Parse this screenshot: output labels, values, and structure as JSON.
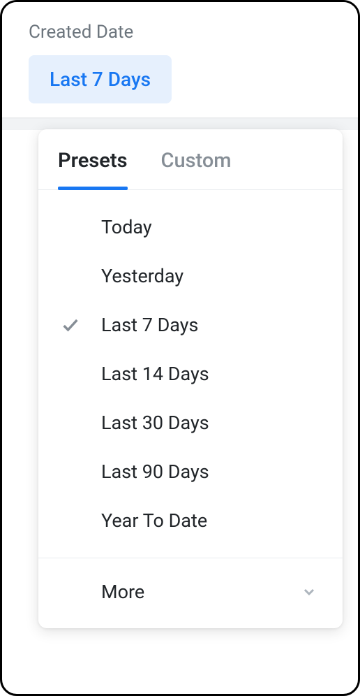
{
  "header": {
    "label": "Created Date",
    "selected": "Last 7 Days"
  },
  "tabs": {
    "active": "Presets",
    "presets_label": "Presets",
    "custom_label": "Custom"
  },
  "presets": [
    {
      "label": "Today",
      "selected": false
    },
    {
      "label": "Yesterday",
      "selected": false
    },
    {
      "label": "Last 7 Days",
      "selected": true
    },
    {
      "label": "Last 14 Days",
      "selected": false
    },
    {
      "label": "Last 30 Days",
      "selected": false
    },
    {
      "label": "Last 90 Days",
      "selected": false
    },
    {
      "label": "Year To Date",
      "selected": false
    }
  ],
  "more_label": "More"
}
